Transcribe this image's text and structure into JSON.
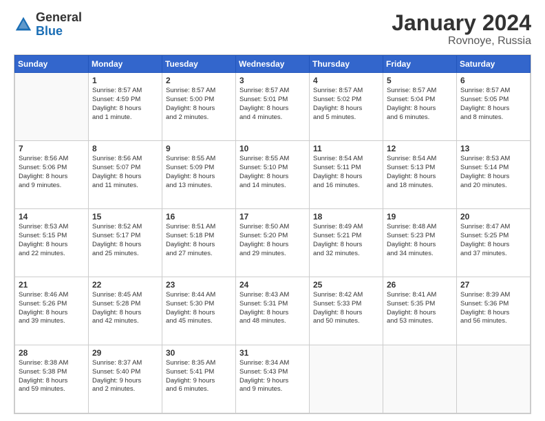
{
  "logo": {
    "general": "General",
    "blue": "Blue"
  },
  "title": "January 2024",
  "subtitle": "Rovnoye, Russia",
  "days_header": [
    "Sunday",
    "Monday",
    "Tuesday",
    "Wednesday",
    "Thursday",
    "Friday",
    "Saturday"
  ],
  "weeks": [
    [
      {
        "day": "",
        "info": ""
      },
      {
        "day": "1",
        "info": "Sunrise: 8:57 AM\nSunset: 4:59 PM\nDaylight: 8 hours\nand 1 minute."
      },
      {
        "day": "2",
        "info": "Sunrise: 8:57 AM\nSunset: 5:00 PM\nDaylight: 8 hours\nand 2 minutes."
      },
      {
        "day": "3",
        "info": "Sunrise: 8:57 AM\nSunset: 5:01 PM\nDaylight: 8 hours\nand 4 minutes."
      },
      {
        "day": "4",
        "info": "Sunrise: 8:57 AM\nSunset: 5:02 PM\nDaylight: 8 hours\nand 5 minutes."
      },
      {
        "day": "5",
        "info": "Sunrise: 8:57 AM\nSunset: 5:04 PM\nDaylight: 8 hours\nand 6 minutes."
      },
      {
        "day": "6",
        "info": "Sunrise: 8:57 AM\nSunset: 5:05 PM\nDaylight: 8 hours\nand 8 minutes."
      }
    ],
    [
      {
        "day": "7",
        "info": "Sunrise: 8:56 AM\nSunset: 5:06 PM\nDaylight: 8 hours\nand 9 minutes."
      },
      {
        "day": "8",
        "info": "Sunrise: 8:56 AM\nSunset: 5:07 PM\nDaylight: 8 hours\nand 11 minutes."
      },
      {
        "day": "9",
        "info": "Sunrise: 8:55 AM\nSunset: 5:09 PM\nDaylight: 8 hours\nand 13 minutes."
      },
      {
        "day": "10",
        "info": "Sunrise: 8:55 AM\nSunset: 5:10 PM\nDaylight: 8 hours\nand 14 minutes."
      },
      {
        "day": "11",
        "info": "Sunrise: 8:54 AM\nSunset: 5:11 PM\nDaylight: 8 hours\nand 16 minutes."
      },
      {
        "day": "12",
        "info": "Sunrise: 8:54 AM\nSunset: 5:13 PM\nDaylight: 8 hours\nand 18 minutes."
      },
      {
        "day": "13",
        "info": "Sunrise: 8:53 AM\nSunset: 5:14 PM\nDaylight: 8 hours\nand 20 minutes."
      }
    ],
    [
      {
        "day": "14",
        "info": "Sunrise: 8:53 AM\nSunset: 5:15 PM\nDaylight: 8 hours\nand 22 minutes."
      },
      {
        "day": "15",
        "info": "Sunrise: 8:52 AM\nSunset: 5:17 PM\nDaylight: 8 hours\nand 25 minutes."
      },
      {
        "day": "16",
        "info": "Sunrise: 8:51 AM\nSunset: 5:18 PM\nDaylight: 8 hours\nand 27 minutes."
      },
      {
        "day": "17",
        "info": "Sunrise: 8:50 AM\nSunset: 5:20 PM\nDaylight: 8 hours\nand 29 minutes."
      },
      {
        "day": "18",
        "info": "Sunrise: 8:49 AM\nSunset: 5:21 PM\nDaylight: 8 hours\nand 32 minutes."
      },
      {
        "day": "19",
        "info": "Sunrise: 8:48 AM\nSunset: 5:23 PM\nDaylight: 8 hours\nand 34 minutes."
      },
      {
        "day": "20",
        "info": "Sunrise: 8:47 AM\nSunset: 5:25 PM\nDaylight: 8 hours\nand 37 minutes."
      }
    ],
    [
      {
        "day": "21",
        "info": "Sunrise: 8:46 AM\nSunset: 5:26 PM\nDaylight: 8 hours\nand 39 minutes."
      },
      {
        "day": "22",
        "info": "Sunrise: 8:45 AM\nSunset: 5:28 PM\nDaylight: 8 hours\nand 42 minutes."
      },
      {
        "day": "23",
        "info": "Sunrise: 8:44 AM\nSunset: 5:30 PM\nDaylight: 8 hours\nand 45 minutes."
      },
      {
        "day": "24",
        "info": "Sunrise: 8:43 AM\nSunset: 5:31 PM\nDaylight: 8 hours\nand 48 minutes."
      },
      {
        "day": "25",
        "info": "Sunrise: 8:42 AM\nSunset: 5:33 PM\nDaylight: 8 hours\nand 50 minutes."
      },
      {
        "day": "26",
        "info": "Sunrise: 8:41 AM\nSunset: 5:35 PM\nDaylight: 8 hours\nand 53 minutes."
      },
      {
        "day": "27",
        "info": "Sunrise: 8:39 AM\nSunset: 5:36 PM\nDaylight: 8 hours\nand 56 minutes."
      }
    ],
    [
      {
        "day": "28",
        "info": "Sunrise: 8:38 AM\nSunset: 5:38 PM\nDaylight: 8 hours\nand 59 minutes."
      },
      {
        "day": "29",
        "info": "Sunrise: 8:37 AM\nSunset: 5:40 PM\nDaylight: 9 hours\nand 2 minutes."
      },
      {
        "day": "30",
        "info": "Sunrise: 8:35 AM\nSunset: 5:41 PM\nDaylight: 9 hours\nand 6 minutes."
      },
      {
        "day": "31",
        "info": "Sunrise: 8:34 AM\nSunset: 5:43 PM\nDaylight: 9 hours\nand 9 minutes."
      },
      {
        "day": "",
        "info": ""
      },
      {
        "day": "",
        "info": ""
      },
      {
        "day": "",
        "info": ""
      }
    ]
  ]
}
